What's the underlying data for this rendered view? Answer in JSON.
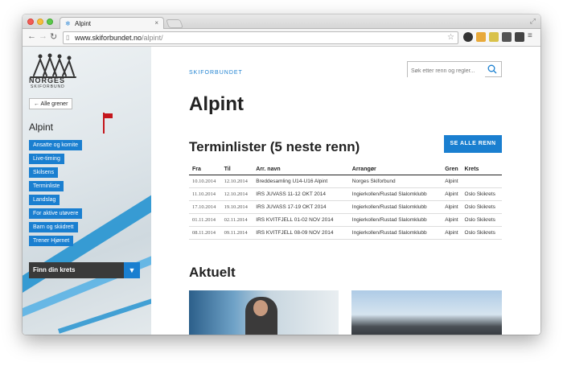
{
  "browser": {
    "tab_title": "Alpint",
    "url_host": "www.skiforbundet.no",
    "url_path": "/alpint/"
  },
  "sidebar": {
    "logo_text": "NORGES",
    "logo_sub": "SKIFORBUND",
    "back_label": "← Alle grener",
    "section_title": "Alpint",
    "items": [
      {
        "label": "Ansatte og komite"
      },
      {
        "label": "Live-timing"
      },
      {
        "label": "Skilsens"
      },
      {
        "label": "Terminliste"
      },
      {
        "label": "Landslag"
      },
      {
        "label": "For aktive utøvere"
      },
      {
        "label": "Barn og skiidrett"
      },
      {
        "label": "Trener Hjørnet"
      }
    ],
    "krets_label": "Finn din krets"
  },
  "main": {
    "section_tag": "SKIFORBUNDET",
    "search_placeholder": "Søk etter renn og regler...",
    "page_title": "Alpint",
    "terminlister_title": "Terminlister (5 neste renn)",
    "see_all_label": "SE ALLE RENN",
    "table": {
      "headers": [
        "Fra",
        "Til",
        "Arr. navn",
        "Arrangør",
        "Gren",
        "Krets"
      ],
      "rows": [
        [
          "10.10.2014",
          "12.10.2014",
          "Breddesamling U14-U16 Alpint",
          "Norges Skiforbund",
          "Alpint",
          ""
        ],
        [
          "11.10.2014",
          "12.10.2014",
          "IRS JUVASS 11-12 OKT 2014",
          "Ingierkollen/Rustad Slalomklubb",
          "Alpint",
          "Oslo Skikrets"
        ],
        [
          "17.10.2014",
          "19.10.2014",
          "IRS JUVASS 17-19 OKT 2014",
          "Ingierkollen/Rustad Slalomklubb",
          "Alpint",
          "Oslo Skikrets"
        ],
        [
          "01.11.2014",
          "02.11.2014",
          "IRS KVITFJELL 01-02 NOV 2014",
          "Ingierkollen/Rustad Slalomklubb",
          "Alpint",
          "Oslo Skikrets"
        ],
        [
          "08.11.2014",
          "09.11.2014",
          "IRS KVITFJELL 08-09 NOV 2014",
          "Ingierkollen/Rustad Slalomklubb",
          "Alpint",
          "Oslo Skikrets"
        ]
      ]
    },
    "news_title": "Aktuelt"
  },
  "colors": {
    "accent": "#1a7fd0",
    "dark": "#3a3a3a"
  }
}
